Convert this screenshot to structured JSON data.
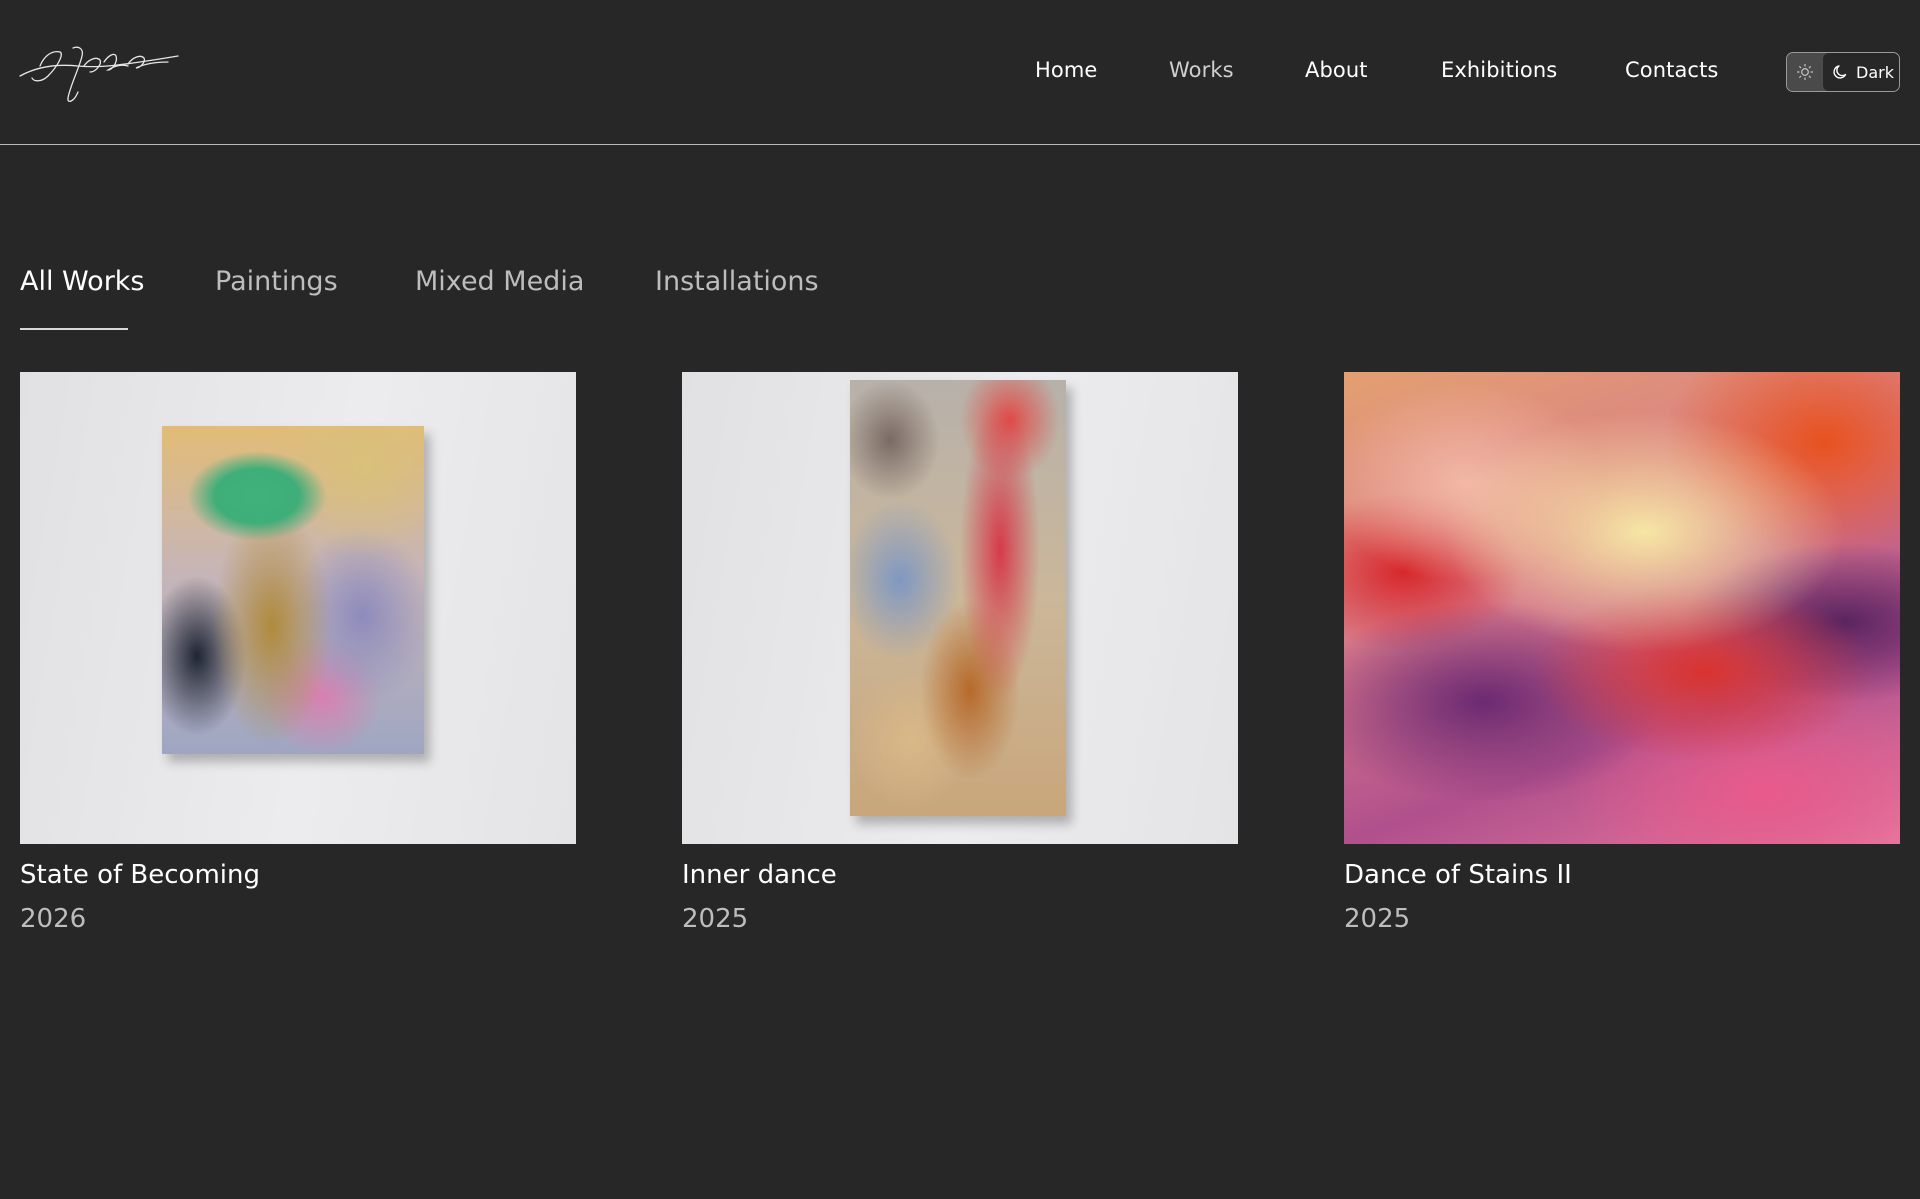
{
  "header": {
    "nav": [
      {
        "label": "Home",
        "active": false
      },
      {
        "label": "Works",
        "active": true
      },
      {
        "label": "About",
        "active": false
      },
      {
        "label": "Exhibitions",
        "active": false
      },
      {
        "label": "Contacts",
        "active": false
      }
    ],
    "theme_toggle": {
      "label": "Dark",
      "light_icon": "sun-icon",
      "dark_icon": "moon-icon",
      "selected": "dark"
    }
  },
  "filters": {
    "tabs": [
      {
        "label": "All Works",
        "active": true
      },
      {
        "label": "Paintings",
        "active": false
      },
      {
        "label": "Mixed Media",
        "active": false
      },
      {
        "label": "Installations",
        "active": false
      }
    ]
  },
  "works": [
    {
      "title": "State of Becoming",
      "year": "2026"
    },
    {
      "title": "Inner dance",
      "year": "2025"
    },
    {
      "title": "Dance of Stains II",
      "year": "2025"
    }
  ],
  "colors": {
    "background": "#272727",
    "text": "#ffffff",
    "muted_text": "#bdbdbd",
    "divider": "#bdbdbd"
  }
}
